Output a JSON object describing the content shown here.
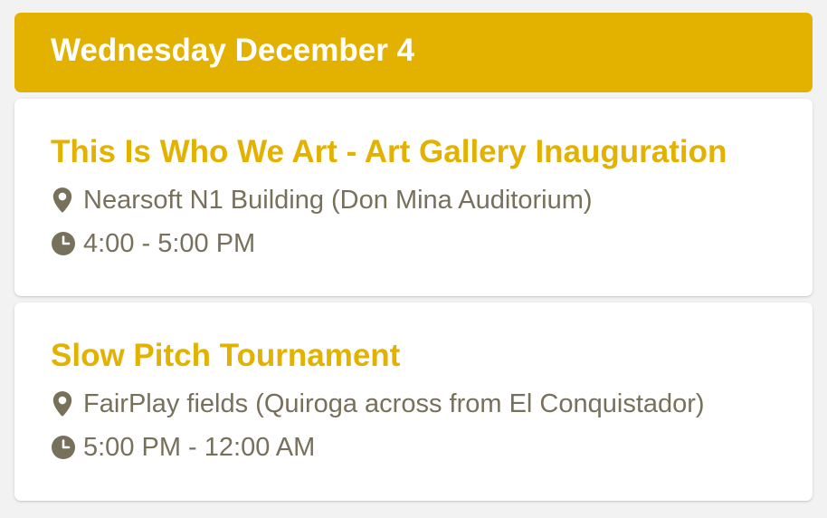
{
  "day": {
    "title": "Wednesday December 4"
  },
  "events": [
    {
      "title": "This Is Who We Art - Art Gallery Inauguration",
      "location": "Nearsoft N1 Building (Don Mina Auditorium)",
      "time": "4:00 - 5:00 PM",
      "location_icon": "map-pin-icon",
      "time_icon": "clock-icon"
    },
    {
      "title": "Slow Pitch Tournament",
      "location": "FairPlay fields (Quiroga across from El Conquistador)",
      "time": "5:00 PM - 12:00 AM",
      "location_icon": "map-pin-icon",
      "time_icon": "clock-icon"
    }
  ],
  "colors": {
    "accent": "#e3b100",
    "meta_text": "#77705a",
    "card_background": "#ffffff",
    "page_background": "#f2f2f2"
  }
}
